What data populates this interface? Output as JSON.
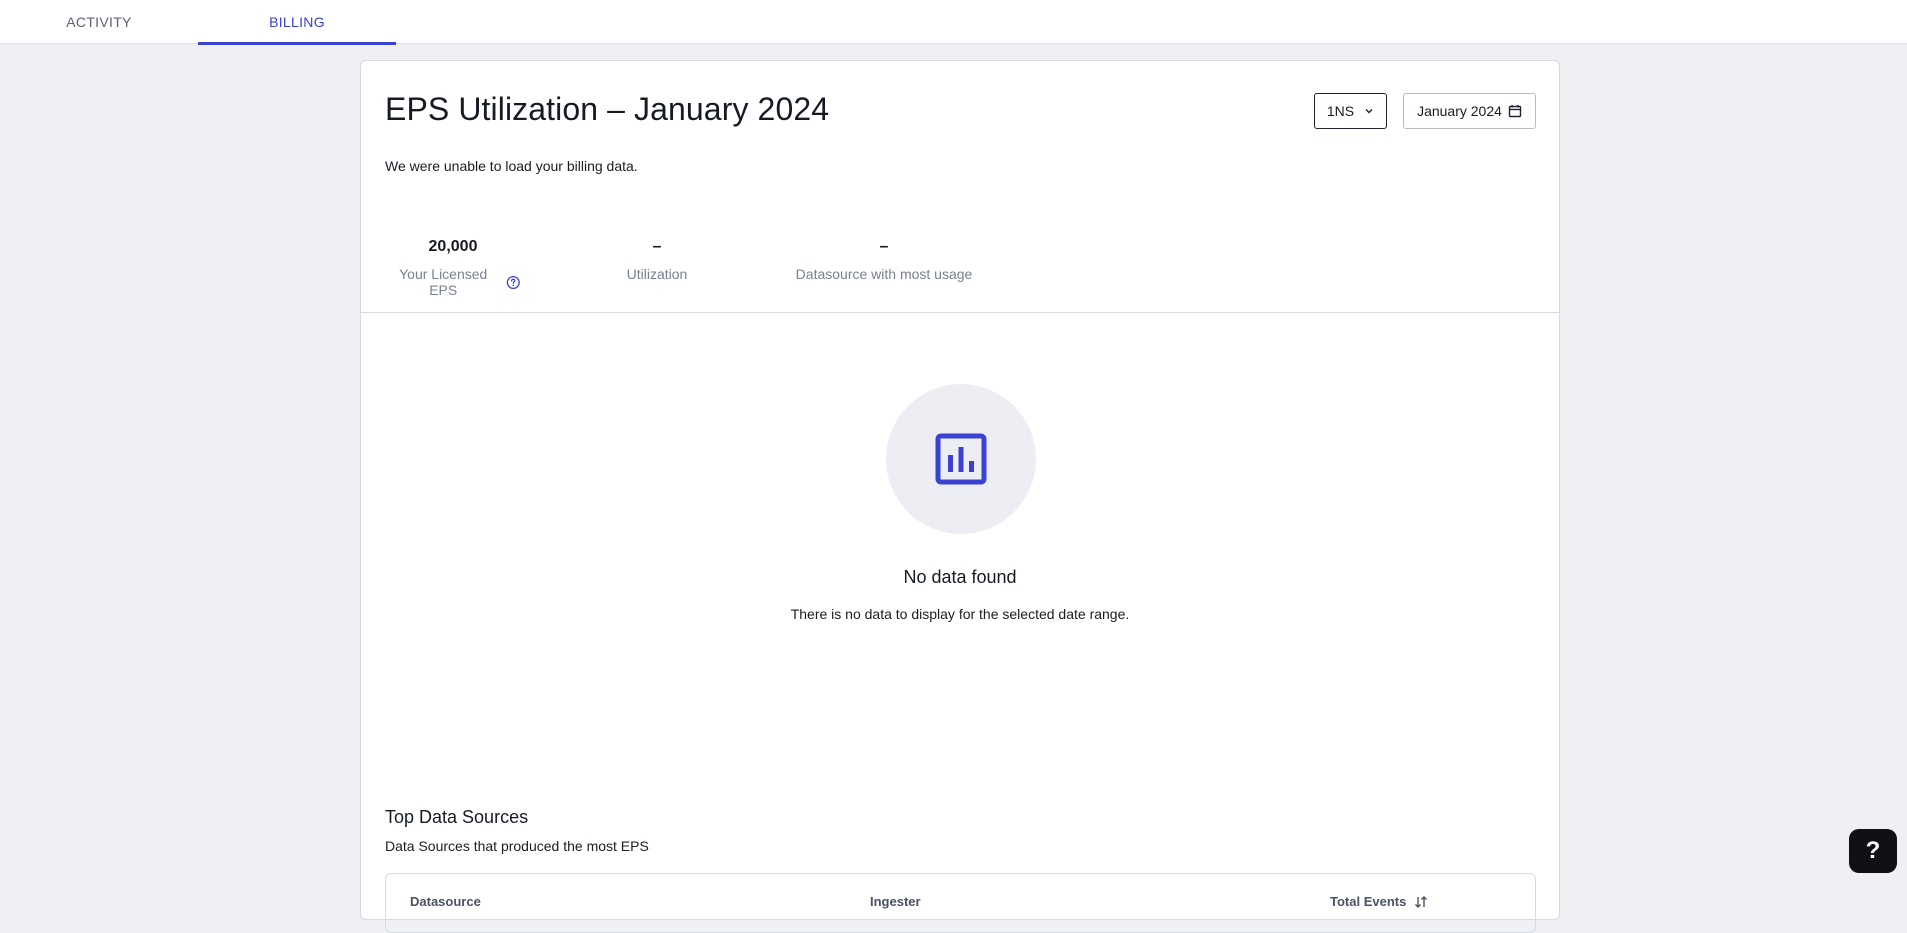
{
  "tabs": {
    "activity": "ACTIVITY",
    "billing": "BILLING"
  },
  "header": {
    "title": "EPS Utilization – January 2024",
    "namespace_select": "1NS",
    "date_picker": "January 2024"
  },
  "status": {
    "error_message": "We were unable to load your billing data."
  },
  "stats": [
    {
      "value": "20,000",
      "label": "Your Licensed EPS"
    },
    {
      "value": "–",
      "label": "Utilization"
    },
    {
      "value": "–",
      "label": "Datasource with most usage"
    }
  ],
  "empty_state": {
    "title": "No data found",
    "subtitle": "There is no data to display for the selected date range."
  },
  "top_sources": {
    "title": "Top Data Sources",
    "subtitle": "Data Sources that produced the most EPS",
    "columns": [
      "Datasource",
      "Ingester",
      "Total Events"
    ]
  },
  "help_fab": "?",
  "colors": {
    "accent": "#3b42d1",
    "page_bg": "#eef0f4",
    "muted_text": "#7a8090",
    "fab_bg": "#0f1116"
  }
}
